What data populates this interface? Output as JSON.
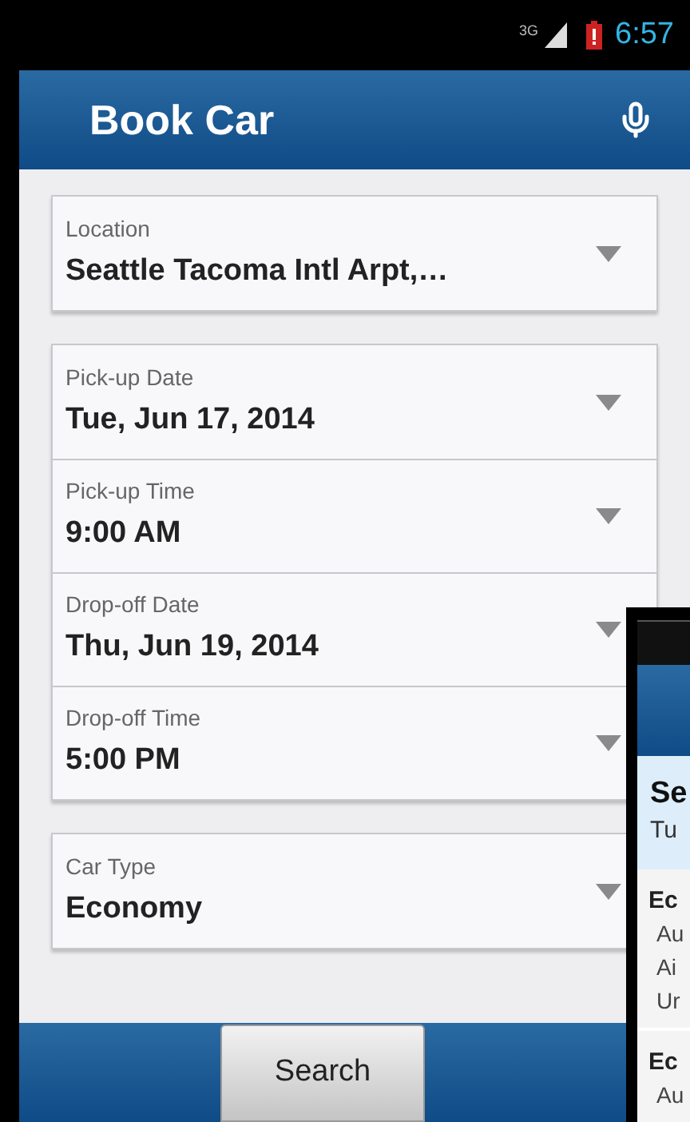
{
  "status_bar": {
    "network": "3G",
    "time": "6:57"
  },
  "header": {
    "title": "Book Car"
  },
  "cards": [
    {
      "fields": [
        {
          "label": "Location",
          "value": "Seattle Tacoma Intl Arpt,…"
        }
      ]
    },
    {
      "fields": [
        {
          "label": "Pick-up Date",
          "value": "Tue, Jun 17, 2014"
        },
        {
          "label": "Pick-up Time",
          "value": "9:00 AM"
        },
        {
          "label": "Drop-off Date",
          "value": "Thu, Jun 19, 2014"
        },
        {
          "label": "Drop-off Time",
          "value": "5:00 PM"
        }
      ]
    },
    {
      "fields": [
        {
          "label": "Car Type",
          "value": "Economy"
        }
      ]
    }
  ],
  "search_button": "Search",
  "second_screen": {
    "heading": "Se",
    "subheading": "Tu",
    "groups": [
      {
        "title": "Ec",
        "lines": [
          "Au",
          "Ai",
          "Ur"
        ]
      },
      {
        "title": "Ec",
        "lines": [
          "Au"
        ]
      }
    ]
  }
}
